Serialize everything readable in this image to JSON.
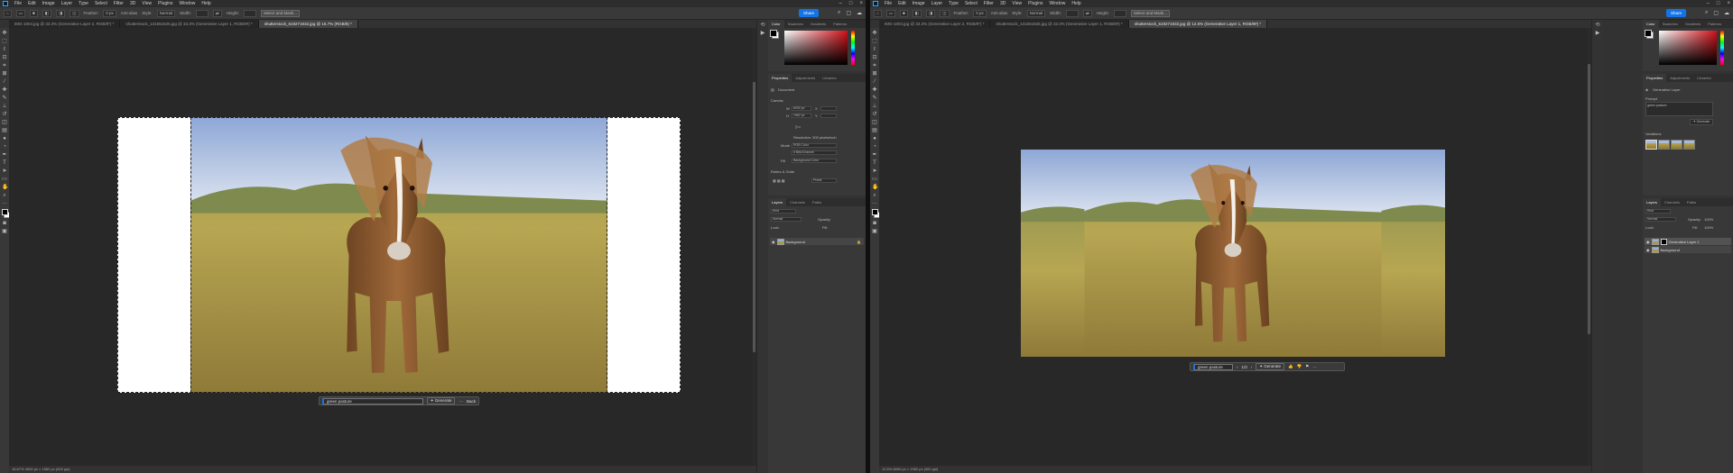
{
  "menu": {
    "items": [
      "File",
      "Edit",
      "Image",
      "Layer",
      "Type",
      "Select",
      "Filter",
      "3D",
      "View",
      "Plugins",
      "Window",
      "Help"
    ]
  },
  "options": {
    "feather_label": "Feather:",
    "feather_value": "0 px",
    "antialias": "Anti-alias",
    "style_label": "Style:",
    "style_value": "Normal",
    "width_label": "Width:",
    "height_label": "Height:",
    "select_mask": "Select and Mask...",
    "share": "Share"
  },
  "left": {
    "tabs": [
      "IMG-1004.jpg @ 33.3% (Generative Layer 2, RGB/8*) *",
      "shutterstock_131651625.jpg @ 33.3% (Generative Layer 1, RGB/8#) *",
      "shutterstock_619271932.jpg @ 16.7% (RGB/8) *"
    ],
    "status": "16.67%    4000 px × 1962 px (300 ppi)",
    "prompt_value": "green pasture",
    "generate": "Generate",
    "more": "···",
    "back": "Back",
    "properties": {
      "tabs": [
        "Properties",
        "Adjustments",
        "Libraries"
      ],
      "doc": "Document",
      "canvas": "Canvas",
      "w_label": "W",
      "w_value": "6000 px",
      "h_label": "H",
      "h_value": "1962 px",
      "x_label": "X",
      "y_label": "Y",
      "resolution": "Resolution: 300 pixels/inch",
      "mode_label": "Mode",
      "mode_value": "RGB Color",
      "depth_value": "8 Bits/Channel",
      "fill_label": "Fill",
      "fill_value": "Background Color",
      "rulers": "Rulers & Grids",
      "units_value": "Pixels"
    },
    "color_tabs": [
      "Color",
      "Swatches",
      "Gradients",
      "Patterns"
    ],
    "layers": {
      "tabs": [
        "Layers",
        "Channels",
        "Paths"
      ],
      "kind": "Kind",
      "blend": "Normal",
      "opacity_label": "Opacity:",
      "lock_label": "Lock:",
      "fill_label": "Fill:",
      "rows": [
        "Background"
      ]
    }
  },
  "right": {
    "tabs": [
      "IMG-1004.jpg @ 33.3% (Generative Layer 2, RGB/8*) *",
      "shutterstock_131651625.jpg @ 33.3% (Generative Layer 1, RGB/8#) *",
      "shutterstock_619271932.jpg @ 12.5% (Generative Layer 1, RGB/8#) *"
    ],
    "status": "12.5%    6000 px × 1962 px (300 ppi)",
    "prompt_value": "green pasture",
    "pager": "1/3",
    "generate": "Generate",
    "more": "···",
    "properties": {
      "tabs": [
        "Properties",
        "Adjustments",
        "Libraries"
      ],
      "layer_type": "Generative Layer",
      "prompt_label": "Prompt",
      "prompt_value": "green pasture",
      "generate": "Generate",
      "variations": "Variations"
    },
    "color_tabs": [
      "Color",
      "Swatches",
      "Gradients",
      "Patterns"
    ],
    "layers": {
      "tabs": [
        "Layers",
        "Channels",
        "Paths"
      ],
      "kind": "Kind",
      "blend": "Normal",
      "opacity_label": "Opacity:",
      "opacity_value": "100%",
      "lock_label": "Lock:",
      "fill_label": "Fill:",
      "fill_value": "100%",
      "rows": [
        "Generative Layer 1",
        "Background"
      ]
    }
  },
  "colors": {
    "accent": "#1473e6",
    "sky": "#9fb6dc",
    "grass": "#b3a24b",
    "horse": "#8a5a2b"
  }
}
